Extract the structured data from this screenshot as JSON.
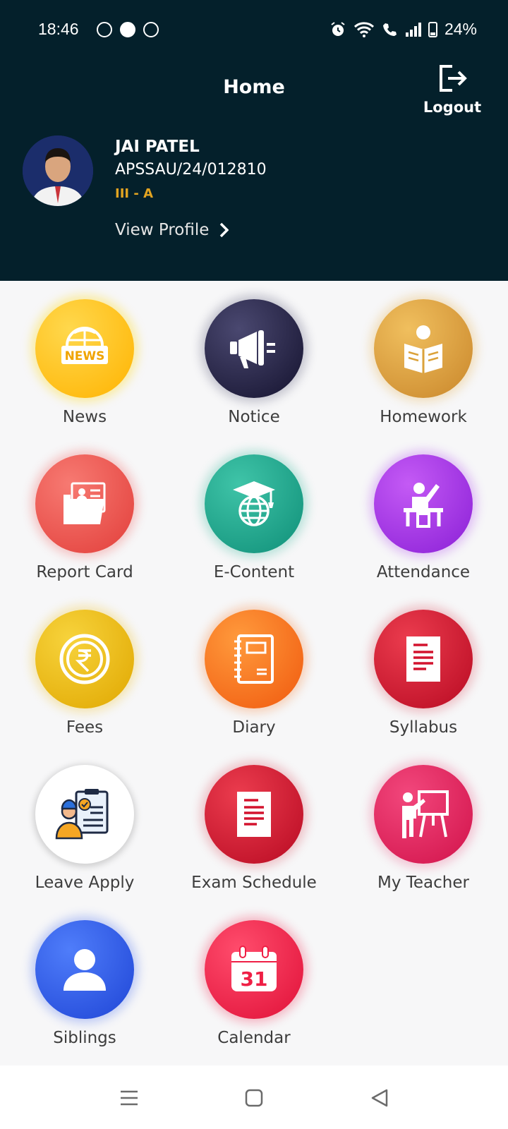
{
  "status_bar": {
    "time": "18:46",
    "battery": "24%",
    "icons": [
      "whatsapp-icon",
      "app-icon",
      "chrome-icon",
      "alarm-icon",
      "wifi-icon",
      "call-icon",
      "signal-icon",
      "battery-icon"
    ]
  },
  "header": {
    "title": "Home",
    "logout_label": "Logout",
    "background": "#04202b"
  },
  "student": {
    "name": "JAI PATEL",
    "id": "APSSAU/24/012810",
    "class": "III - A",
    "view_profile": "View Profile"
  },
  "menu": [
    {
      "label": "News",
      "icon": "news-icon",
      "color": "#ffc107"
    },
    {
      "label": "Notice",
      "icon": "megaphone-icon",
      "color": "#2d2b52"
    },
    {
      "label": "Homework",
      "icon": "reading-icon",
      "color": "#dba23a"
    },
    {
      "label": "Report Card",
      "icon": "report-folder-icon",
      "color": "#ef5350"
    },
    {
      "label": "E-Content",
      "icon": "graduation-globe-icon",
      "color": "#1fa08a"
    },
    {
      "label": "Attendance",
      "icon": "student-raising-hand-icon",
      "color": "#a335e8"
    },
    {
      "label": "Fees",
      "icon": "rupee-coin-icon",
      "color": "#f0bc0f"
    },
    {
      "label": "Diary",
      "icon": "diary-icon",
      "color": "#f5731f"
    },
    {
      "label": "Syllabus",
      "icon": "document-icon",
      "color": "#d3132e"
    },
    {
      "label": "Leave Apply",
      "icon": "leave-form-icon",
      "color": "#ffffff"
    },
    {
      "label": "Exam Schedule",
      "icon": "exam-document-icon",
      "color": "#d3132e"
    },
    {
      "label": "My Teacher",
      "icon": "teacher-board-icon",
      "color": "#e91e63"
    },
    {
      "label": "Siblings",
      "icon": "person-icon",
      "color": "#2f5ff0"
    },
    {
      "label": "Calendar",
      "icon": "calendar-icon",
      "color": "#ef1f45"
    }
  ],
  "calendar_day": "31",
  "nav": {
    "icons": [
      "menu-icon",
      "home-square-icon",
      "back-triangle-icon"
    ]
  }
}
